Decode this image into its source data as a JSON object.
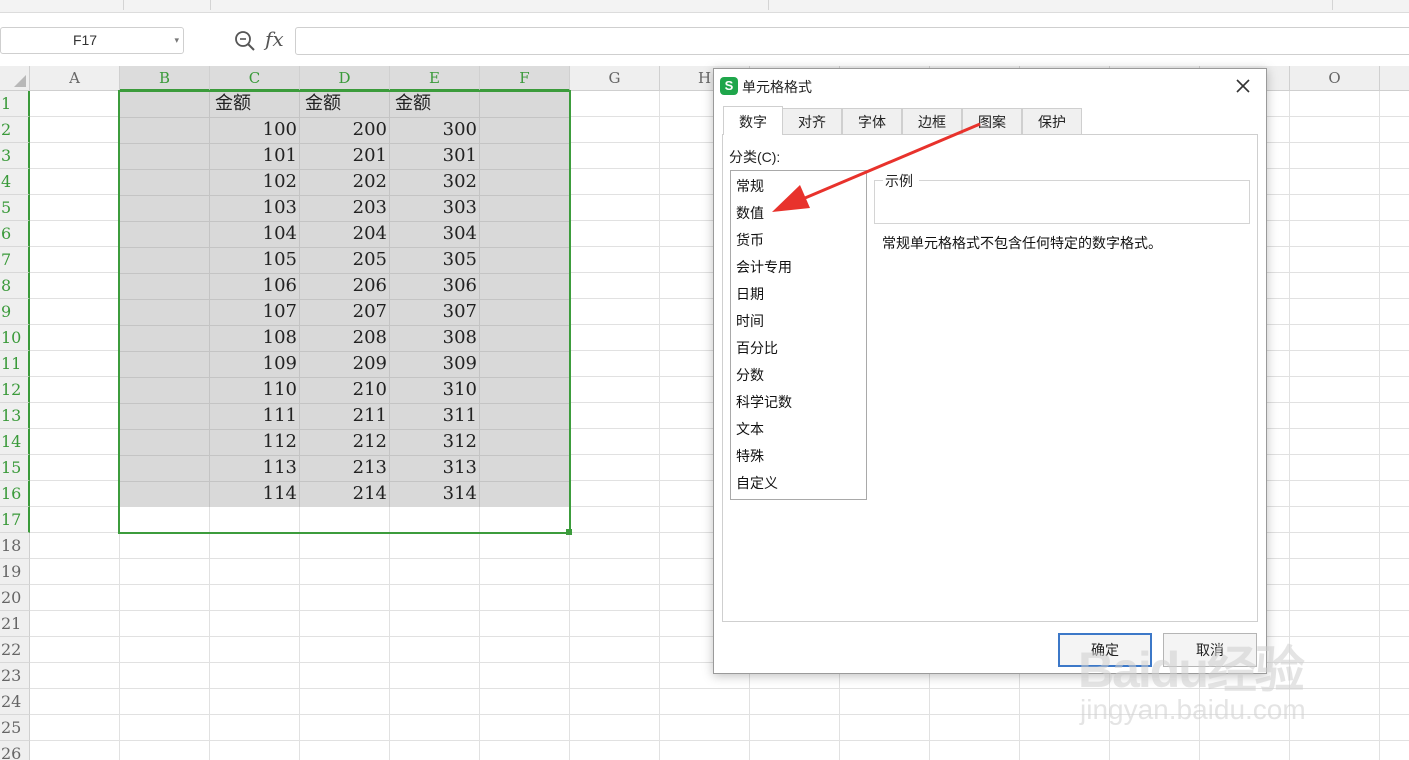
{
  "formula_bar": {
    "name_box": "F17",
    "name_box_dropdown": "▾",
    "fx_label": "fx",
    "formula_value": ""
  },
  "grid": {
    "columns": [
      "A",
      "B",
      "C",
      "D",
      "E",
      "F",
      "G",
      "H",
      "O"
    ],
    "selected_columns": [
      "B",
      "C",
      "D",
      "E",
      "F"
    ],
    "rows": [
      "1",
      "2",
      "3",
      "4",
      "5",
      "6",
      "7",
      "8",
      "9",
      "10",
      "11",
      "12",
      "13",
      "14",
      "15",
      "16",
      "17",
      "18",
      "19",
      "20",
      "21",
      "22",
      "23",
      "24",
      "25",
      "26"
    ],
    "selected_rows": [
      "1",
      "2",
      "3",
      "4",
      "5",
      "6",
      "7",
      "8",
      "9",
      "10",
      "11",
      "12",
      "13",
      "14",
      "15",
      "16",
      "17"
    ],
    "headers": {
      "C": "金额",
      "D": "金额",
      "E": "金额"
    },
    "values_C": [
      "100",
      "101",
      "102",
      "103",
      "104",
      "105",
      "106",
      "107",
      "108",
      "109",
      "110",
      "111",
      "112",
      "113",
      "114"
    ],
    "values_D": [
      "200",
      "201",
      "202",
      "203",
      "204",
      "205",
      "206",
      "207",
      "208",
      "209",
      "210",
      "211",
      "212",
      "213",
      "214"
    ],
    "values_E": [
      "300",
      "301",
      "302",
      "303",
      "304",
      "305",
      "306",
      "307",
      "308",
      "309",
      "310",
      "311",
      "312",
      "313",
      "314"
    ]
  },
  "dialog": {
    "app_icon_letter": "S",
    "title": "单元格格式",
    "tabs": [
      "数字",
      "对齐",
      "字体",
      "边框",
      "图案",
      "保护"
    ],
    "active_tab": "数字",
    "category_label": "分类(C):",
    "categories": [
      "常规",
      "数值",
      "货币",
      "会计专用",
      "日期",
      "时间",
      "百分比",
      "分数",
      "科学记数",
      "文本",
      "特殊",
      "自定义"
    ],
    "example_label": "示例",
    "description": "常规单元格格式不包含任何特定的数字格式。",
    "ok_label": "确定",
    "cancel_label": "取消"
  },
  "annotation": {
    "arrow_color": "#e8322c",
    "points_to": "数值"
  },
  "watermark": {
    "logo_text": "Baidu经验",
    "url": "jingyan.baidu.com"
  },
  "colors": {
    "selection_green": "#3c9c3c",
    "selection_fill": "#d9d9d9",
    "ok_border": "#3c78c8",
    "app_icon": "#1fa64b"
  }
}
